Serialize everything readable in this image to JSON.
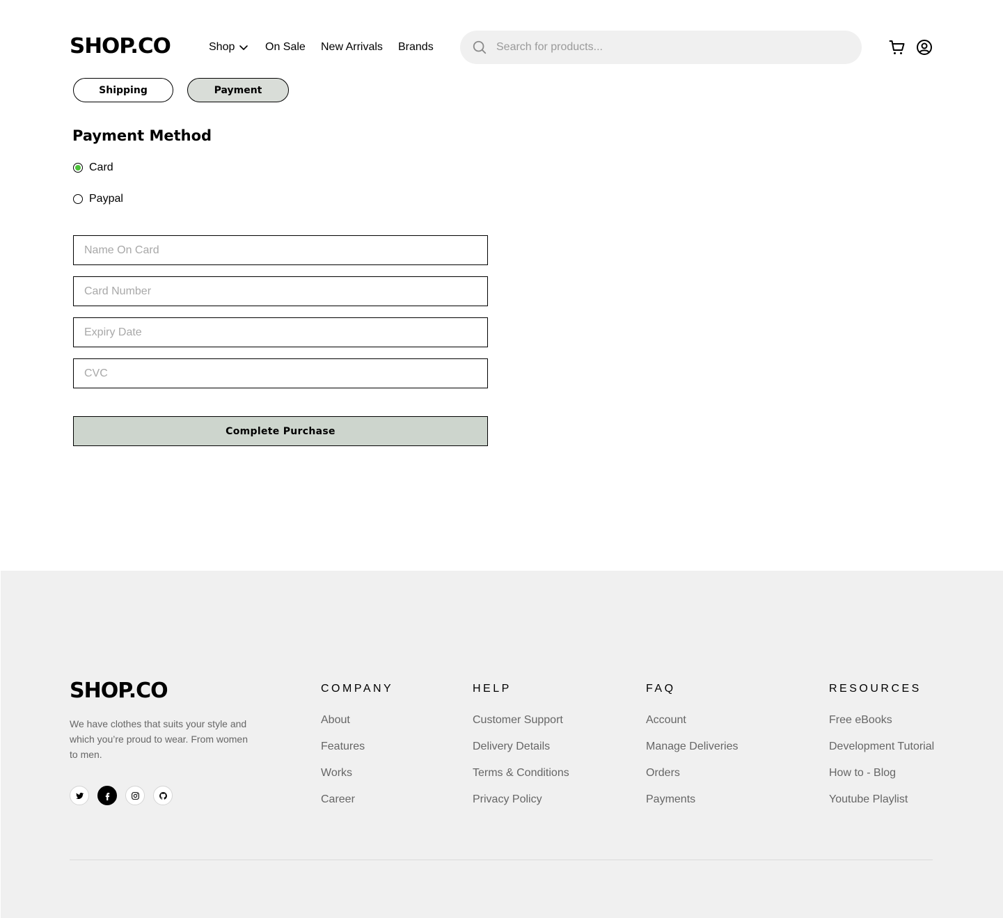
{
  "header": {
    "logo": "SHOP.CO",
    "nav": {
      "shop": "Shop",
      "on_sale": "On Sale",
      "new_arrivals": "New Arrivals",
      "brands": "Brands"
    },
    "search_placeholder": "Search for products...",
    "icons": [
      "search-icon",
      "cart-icon",
      "user-icon",
      "chevron-down-icon"
    ]
  },
  "steps": {
    "shipping": "Shipping",
    "payment": "Payment",
    "active": "Payment"
  },
  "payment": {
    "title": "Payment Method",
    "options": [
      {
        "label": "Card",
        "checked": true
      },
      {
        "label": "Paypal",
        "checked": false
      }
    ],
    "fields": {
      "name_on_card": "Name On Card",
      "card_number": "Card Number",
      "expiry_date": "Expiry Date",
      "cvc": "CVC"
    },
    "submit": "Complete Purchase"
  },
  "footer": {
    "logo": "SHOP.CO",
    "description": "We have clothes that suits your style and which you’re proud to wear. From women to men.",
    "socials": [
      "twitter-icon",
      "facebook-icon",
      "instagram-icon",
      "github-icon"
    ],
    "columns": [
      {
        "title": "COMPANY",
        "links": [
          "About",
          "Features",
          "Works",
          "Career"
        ]
      },
      {
        "title": "HELP",
        "links": [
          "Customer Support",
          "Delivery Details",
          "Terms & Conditions",
          "Privacy Policy"
        ]
      },
      {
        "title": "FAQ",
        "links": [
          "Account",
          "Manage Deliveries",
          "Orders",
          "Payments"
        ]
      },
      {
        "title": "RESOURCES",
        "links": [
          "Free eBooks",
          "Development Tutorial",
          "How to - Blog",
          "Youtube Playlist"
        ]
      }
    ]
  },
  "colors": {
    "active_step_bg": "#d9ddd8",
    "button_bg": "#cdd5cd",
    "radio_checked": "#4cc23a",
    "footer_bg": "#f0f0f0",
    "search_bg": "#f0f0f0"
  }
}
